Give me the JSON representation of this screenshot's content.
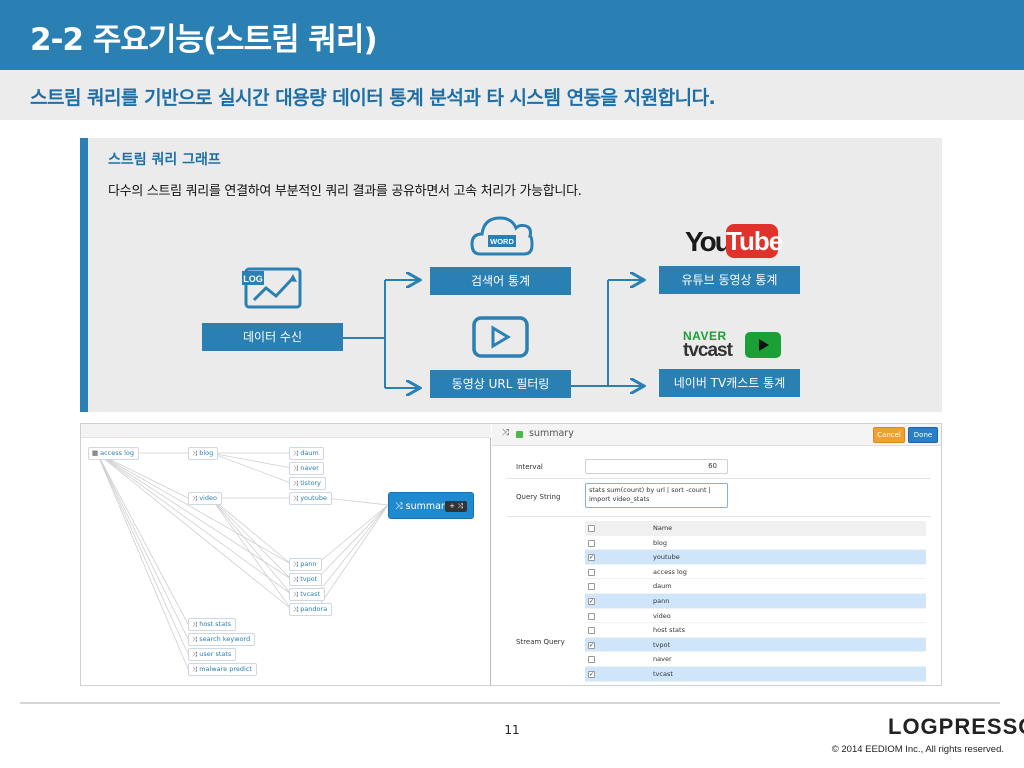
{
  "header": {
    "title": "2-2 주요기능(스트림 쿼리)",
    "subtitle": "스트림 쿼리를 기반으로 실시간 대용량 데이터 통계 분석과 타 시스템 연동을 지원합니다."
  },
  "panel": {
    "title": "스트림 쿼리 그래프",
    "description": "다수의 스트림 쿼리를 연결하여 부분적인 쿼리 결과를 공유하면서 고속 처리가 가능합니다.",
    "nodes": {
      "data_receive": "데이터 수신",
      "search_stats": "검색어 통계",
      "video_url_filtering": "동영상 URL 필터링",
      "youtube_stats": "유튜브 동영상 통계",
      "naver_tv_stats": "네이버 TV캐스트 통계"
    },
    "icons": {
      "log": "LOG",
      "word": "WORD"
    },
    "logos": {
      "youtube_you": "You",
      "youtube_tube": "Tube",
      "naver_top": "NAVER",
      "naver_bottom": "tvcast"
    }
  },
  "graph": {
    "chips": {
      "access_log": "access log",
      "blog": "blog",
      "video": "video",
      "daum": "daum",
      "naver": "naver",
      "tistory": "tistory",
      "youtube": "youtube",
      "pann": "pann",
      "tvpot": "tvpot",
      "tvcast": "tvcast",
      "pandora": "pandora",
      "host_stats": "host stats",
      "search_keyword": "search keyword",
      "user_stats": "user stats",
      "malware_predict": "malware predict",
      "summary": "summary"
    },
    "summary_controls": "+ ⤨"
  },
  "editor": {
    "title": "summary",
    "cancel": "Cancel",
    "done": "Done",
    "interval_label": "Interval",
    "interval_value": "60",
    "query_label": "Query String",
    "query_line1": "stats sum(count) by url | sort -count |",
    "query_line2": "import video_stats",
    "stream_label": "Stream Query",
    "table_header": "Name",
    "rows": [
      {
        "name": "blog",
        "checked": false
      },
      {
        "name": "youtube",
        "checked": true
      },
      {
        "name": "access log",
        "checked": false
      },
      {
        "name": "daum",
        "checked": false
      },
      {
        "name": "pann",
        "checked": true
      },
      {
        "name": "video",
        "checked": false
      },
      {
        "name": "host stats",
        "checked": false
      },
      {
        "name": "tvpot",
        "checked": true
      },
      {
        "name": "naver",
        "checked": false
      },
      {
        "name": "tvcast",
        "checked": true
      }
    ]
  },
  "footer": {
    "page": "11",
    "brand": "LOGPRESSO",
    "copyright": "© 2014 EEDIOM Inc., All rights reserved."
  }
}
